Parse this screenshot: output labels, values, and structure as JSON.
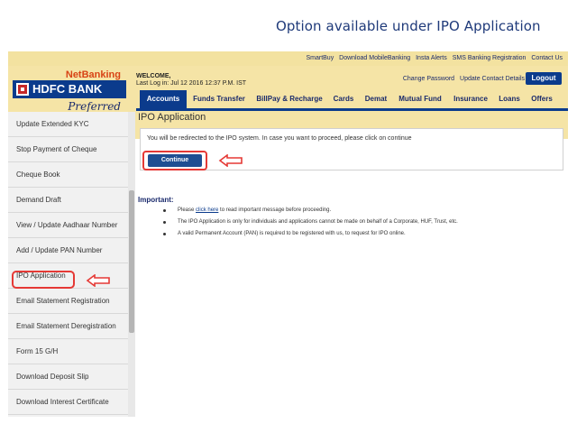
{
  "caption": "Option available under IPO Application",
  "top_links": [
    "SmartBuy",
    "Download MobileBanking",
    "Insta Alerts",
    "SMS Banking Registration",
    "Contact Us"
  ],
  "logo": {
    "netbanking": "NetBanking",
    "bank": "HDFC BANK",
    "preferred": "Preferred"
  },
  "welcome": {
    "title": "WELCOME,",
    "last_login": "Last Log in: Jul 12 2016 12:37 P.M. IST"
  },
  "header_links": [
    "Change Password",
    "Update Contact Details"
  ],
  "logout": "Logout",
  "nav": [
    "Accounts",
    "Funds Transfer",
    "BillPay & Recharge",
    "Cards",
    "Demat",
    "Mutual Fund",
    "Insurance",
    "Loans",
    "Offers"
  ],
  "sidebar": [
    "Update Extended KYC",
    "Stop Payment of Cheque",
    "Cheque Book",
    "Demand Draft",
    "View / Update Aadhaar Number",
    "Add / Update PAN Number",
    "IPO Application",
    "Email Statement Registration",
    "Email Statement Deregistration",
    "Form 15 G/H",
    "Download Deposit Slip",
    "Download Interest Certificate"
  ],
  "main": {
    "title": "IPO Application",
    "notice": "You will be redirected to the IPO system. In case you want to proceed, please click on continue",
    "continue": "Continue",
    "important": "Important:",
    "bullet1_pre": "Please",
    "bullet1_link": "click here",
    "bullet1_post": "to read important message before proceeding.",
    "bullet2": "The IPO Application is only for individuals and applications cannot be made on behalf of a Corporate, HUF, Trust, etc.",
    "bullet3": "A valid Permanent Account (PAN) is required to be registered with us, to request for IPO online."
  },
  "colors": {
    "accent": "#0b3b8c",
    "highlight": "#e53935",
    "header_bg": "#f5e4a6"
  }
}
